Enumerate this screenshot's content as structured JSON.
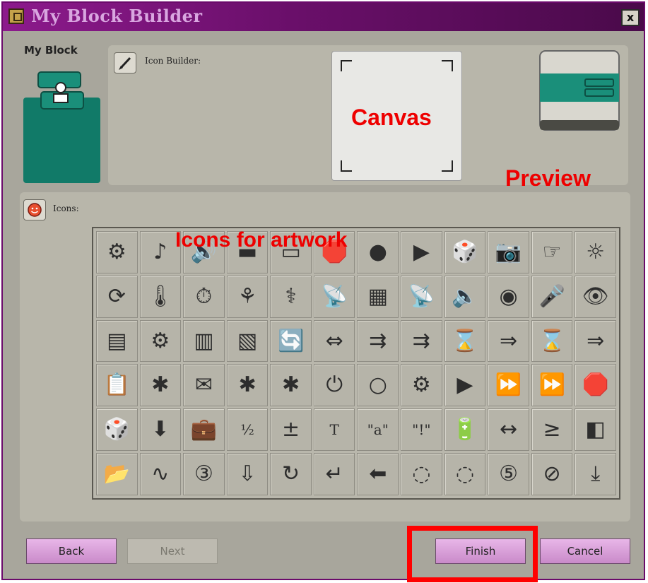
{
  "window": {
    "title": "My Block Builder",
    "close_label": "x"
  },
  "left": {
    "my_block_label": "My Block"
  },
  "top_panel": {
    "icon_builder_label": "Icon Builder:"
  },
  "icons_panel": {
    "label": "Icons:"
  },
  "annotations": {
    "canvas": "Canvas",
    "preview": "Preview",
    "icons_for_artwork": "Icons for artwork"
  },
  "icons": [
    "⚙",
    "♪",
    "🔊",
    "▬",
    "▭",
    "🛑",
    "●",
    "▶",
    "🎲",
    "📷",
    "☞",
    "☼",
    "⟳",
    "🌡",
    "⏱",
    "⚘",
    "⚕",
    "📡",
    "▦",
    "📡",
    "🔈",
    "◉",
    "🎤",
    "👁",
    "▤",
    "⚙",
    "▥",
    "▧",
    "🔄",
    "⇔",
    "⇉",
    "⇉",
    "⌛",
    "⇒",
    "⌛",
    "⇒",
    "📋",
    "✱",
    "✉",
    "✱",
    "✱",
    "⏻",
    "○",
    "⚙",
    "▶",
    "⏩",
    "⏩",
    "🛑",
    "🎲",
    "⬇",
    "💼",
    "½",
    "±",
    "T",
    "\"a\"",
    "\"!\"",
    "🔋",
    "↔",
    "≥",
    "◧",
    "📂",
    "∿",
    "③",
    "⇩",
    "↻",
    "↵",
    "⬅",
    "◌",
    "◌",
    "⑤",
    "⊘",
    "⤓"
  ],
  "text_icons": [
    51,
    53,
    54,
    55
  ],
  "buttons": {
    "back": "Back",
    "next": "Next",
    "finish": "Finish",
    "cancel": "Cancel"
  },
  "colors": {
    "title_bar": "#6a0f6a",
    "block_teal": "#117a68",
    "button_pink": "#d9a0d9",
    "annotation_red": "#ee0000"
  }
}
